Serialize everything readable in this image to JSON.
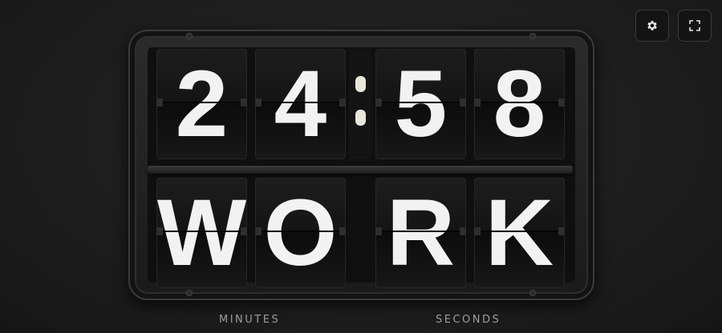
{
  "controls": {
    "settings_icon": "gear-icon",
    "fullscreen_icon": "fullscreen-icon"
  },
  "clock": {
    "digits": [
      "2",
      "4",
      "5",
      "8"
    ],
    "separator": ":"
  },
  "mode": {
    "letters": [
      "W",
      "O",
      "R",
      "K"
    ]
  },
  "labels": {
    "minutes": "MINUTES",
    "seconds": "SECONDS"
  },
  "colors": {
    "background": "#1e1e1e",
    "tile_text": "#f2f2f2",
    "label_text": "#9d9d9d",
    "colon": "#e9e6dc"
  }
}
